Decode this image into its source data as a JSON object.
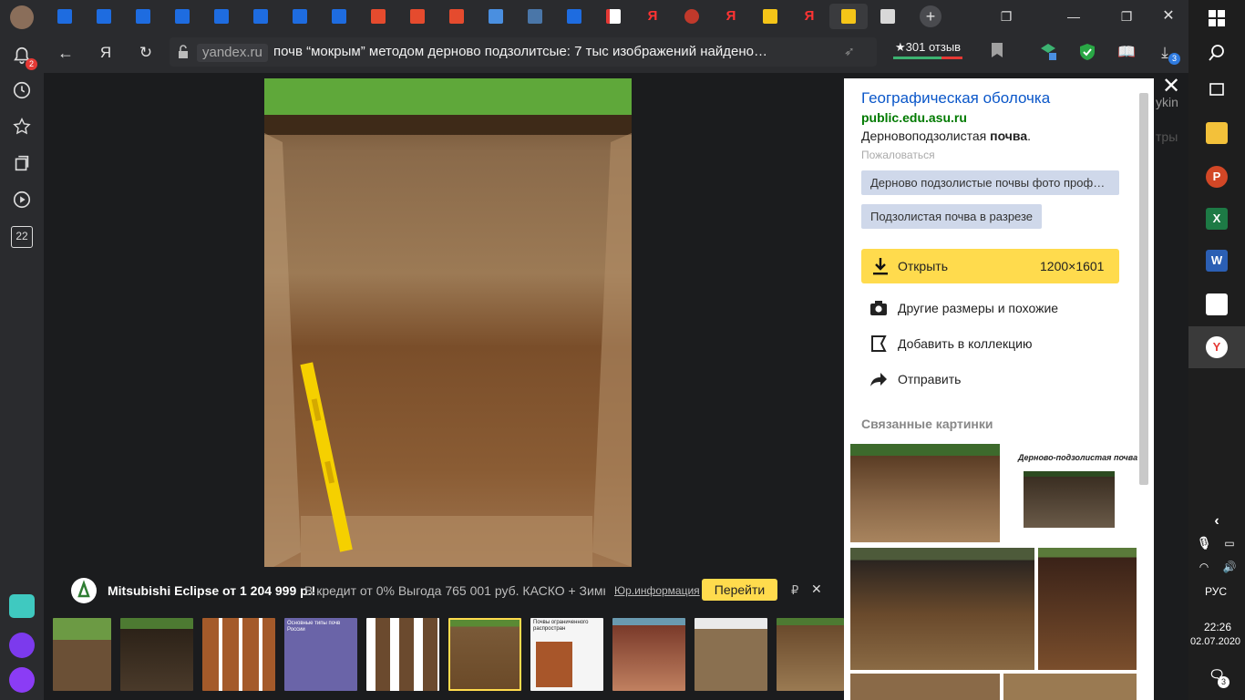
{
  "sidebar": {
    "notification_badge": "2",
    "calendar_day": "22"
  },
  "address_bar": {
    "host": "yandex.ru",
    "title": "почв “мокрым” методом дерново подзолитсые: 7 тыс изображений найдено…",
    "reviews": "★301 отзыв",
    "download_badge": "3"
  },
  "ad": {
    "title": "Mitsubishi Eclipse от 1 204 999 р.!",
    "text": "В кредит от 0% Выгода 765 001 руб. КАСКО + Зимн…",
    "legal": "Юр.информация",
    "cta": "Перейти",
    "currency": "₽"
  },
  "panel": {
    "title": "Географическая оболочка",
    "domain": "public.edu.asu.ru",
    "desc_pre": "Дерновоподзолистая ",
    "desc_bold": "почва",
    "desc_post": ".",
    "report": "Пожаловаться",
    "chips": [
      "Дерново подзолистые почвы фото проф…",
      "Подзолистая почва в разрезе"
    ],
    "open_label": "Открыть",
    "open_size": "1200×1601",
    "actions": [
      "Другие размеры и похожие",
      "Добавить в коллекцию",
      "Отправить"
    ],
    "related_title": "Связанные картинки",
    "related_caption": "Дерново-подзолистая почва"
  },
  "behind": {
    "text1": "ykin",
    "text2": "тры"
  },
  "thumbs": {
    "t4_caption": "Основные типы почв России",
    "t8_caption": "Почвы ограниченного распростран"
  },
  "taskbar": {
    "lang": "РУС",
    "time": "22:26",
    "date": "02.07.2020",
    "notif_count": "3"
  },
  "colors": {
    "accent_yellow": "#ffdb4d",
    "link_blue": "#0b57c9",
    "domain_green": "#007a00"
  }
}
